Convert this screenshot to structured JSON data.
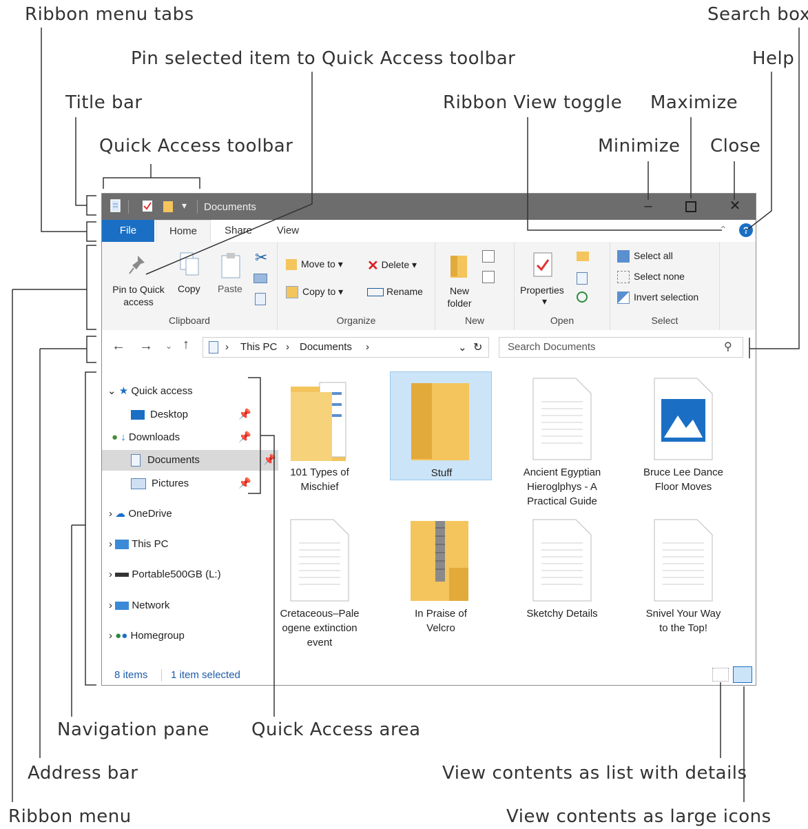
{
  "callouts": {
    "ribbon_menu_tabs": "Ribbon menu tabs",
    "search_box": "Search box",
    "pin_selected": "Pin selected item to Quick Access toolbar",
    "help": "Help",
    "title_bar": "Title bar",
    "ribbon_view_toggle": "Ribbon View toggle",
    "maximize": "Maximize",
    "quick_access_toolbar": "Quick Access toolbar",
    "minimize": "Minimize",
    "close": "Close",
    "navigation_pane": "Navigation pane",
    "quick_access_area": "Quick Access area",
    "address_bar": "Address bar",
    "view_list_details": "View contents as list with details",
    "ribbon_menu": "Ribbon menu",
    "view_large_icons": "View contents as large icons"
  },
  "window": {
    "title": "Documents",
    "tabs": {
      "file": "File",
      "home": "Home",
      "share": "Share",
      "view": "View"
    }
  },
  "ribbon": {
    "clipboard": {
      "pin": "Pin to Quick",
      "pin2": "access",
      "copy": "Copy",
      "paste": "Paste",
      "label": "Clipboard"
    },
    "organize": {
      "move_to": "Move to",
      "copy_to": "Copy to",
      "delete": "Delete",
      "rename": "Rename",
      "label": "Organize"
    },
    "new": {
      "new_folder": "New",
      "new_folder2": "folder",
      "label": "New"
    },
    "open": {
      "properties": "Properties",
      "label": "Open"
    },
    "select": {
      "select_all": "Select all",
      "select_none": "Select none",
      "invert": "Invert selection",
      "label": "Select"
    }
  },
  "address": {
    "crumbs": [
      "This PC",
      "Documents"
    ],
    "search_placeholder": "Search Documents"
  },
  "nav": {
    "quick_access": "Quick access",
    "desktop": "Desktop",
    "downloads": "Downloads",
    "documents": "Documents",
    "pictures": "Pictures",
    "onedrive": "OneDrive",
    "this_pc": "This PC",
    "portable": "Portable500GB (L:)",
    "network": "Network",
    "homegroup": "Homegroup"
  },
  "files": [
    {
      "l1": "101 Types of",
      "l2": "Mischief",
      "l3": "",
      "kind": "folder-docs"
    },
    {
      "l1": "Stuff",
      "l2": "",
      "l3": "",
      "kind": "folder-selected"
    },
    {
      "l1": "Ancient Egyptian",
      "l2": "Hieroglphys - A",
      "l3": "Practical Guide",
      "kind": "document"
    },
    {
      "l1": "Bruce Lee Dance",
      "l2": "Floor Moves",
      "l3": "",
      "kind": "image"
    },
    {
      "l1": "Cretaceous–Pale",
      "l2": "ogene extinction",
      "l3": "event",
      "kind": "document"
    },
    {
      "l1": "In Praise of",
      "l2": "Velcro",
      "l3": "",
      "kind": "zip-folder"
    },
    {
      "l1": "Sketchy Details",
      "l2": "",
      "l3": "",
      "kind": "document"
    },
    {
      "l1": "Snivel Your Way",
      "l2": "to the Top!",
      "l3": "",
      "kind": "document"
    }
  ],
  "status": {
    "count": "8 items",
    "selected": "1 item selected"
  },
  "colors": {
    "accent": "#1a6fc4",
    "title_bar": "#6d6d6d",
    "selection": "#cce4f7",
    "folder": "#f3c55c"
  }
}
